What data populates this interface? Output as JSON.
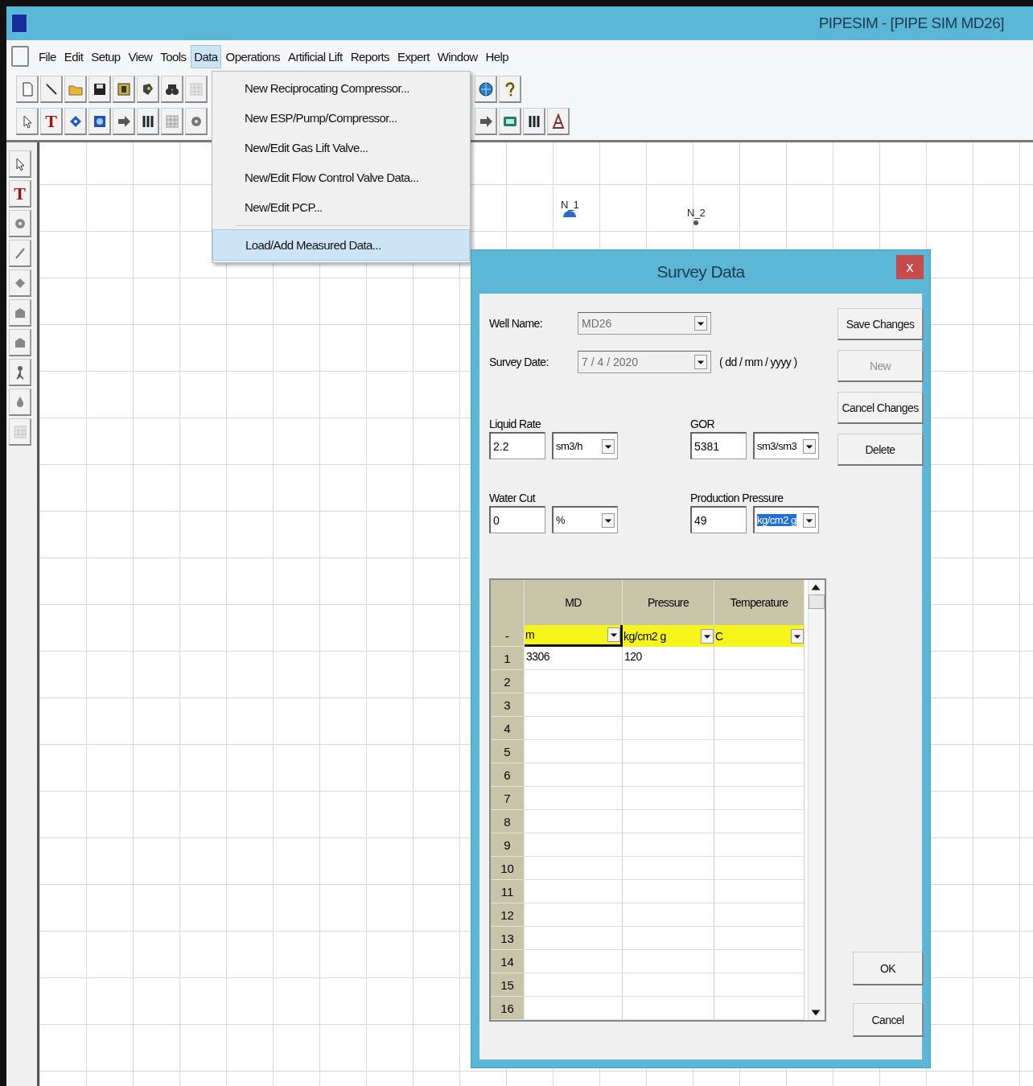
{
  "window": {
    "title": "PIPESIM - [PIPE SIM MD26]"
  },
  "menu_bar": [
    {
      "label": "File",
      "selected": false
    },
    {
      "label": "Edit",
      "selected": false
    },
    {
      "label": "Setup",
      "selected": false
    },
    {
      "label": "View",
      "selected": false
    },
    {
      "label": "Tools",
      "selected": false
    },
    {
      "label": "Data",
      "selected": true
    },
    {
      "label": "Operations",
      "selected": false
    },
    {
      "label": "Artificial Lift",
      "selected": false
    },
    {
      "label": "Reports",
      "selected": false
    },
    {
      "label": "Expert",
      "selected": false
    },
    {
      "label": "Window",
      "selected": false
    },
    {
      "label": "Help",
      "selected": false
    }
  ],
  "toolbar_rows": [
    {
      "groups": [
        [
          {
            "kind": "page"
          },
          {
            "kind": "wand"
          },
          {
            "kind": "folder"
          },
          {
            "kind": "disk"
          },
          {
            "kind": "book"
          },
          {
            "kind": "stamp"
          },
          {
            "kind": "binoculars"
          },
          {
            "kind": "grid",
            "disabled": true
          }
        ],
        [
          {
            "kind": "globe"
          },
          {
            "kind": "bulb"
          }
        ]
      ]
    },
    {
      "groups": [
        [
          {
            "kind": "pointer"
          },
          {
            "kind": "glyph",
            "glyph": "T"
          },
          {
            "kind": "diamond"
          },
          {
            "kind": "square"
          },
          {
            "kind": "arrow"
          },
          {
            "kind": "bars"
          },
          {
            "kind": "grid"
          },
          {
            "kind": "gear"
          }
        ],
        [
          {
            "kind": "arrow"
          },
          {
            "kind": "screen"
          },
          {
            "kind": "bars"
          },
          {
            "kind": "rig"
          }
        ]
      ]
    }
  ],
  "side_toolbar": [
    {
      "kind": "pointer"
    },
    {
      "kind": "glyph",
      "glyph": "T"
    },
    {
      "kind": "circle"
    },
    {
      "kind": "slash"
    },
    {
      "kind": "blob"
    },
    {
      "kind": "well"
    },
    {
      "kind": "well"
    },
    {
      "kind": "figure"
    },
    {
      "kind": "drop"
    },
    {
      "kind": "grid",
      "disabled": true
    }
  ],
  "canvas": {
    "nodes": [
      {
        "label": "N_1",
        "kind": "source"
      },
      {
        "label": "N_2",
        "kind": "junction"
      }
    ]
  },
  "data_menu": {
    "items": [
      {
        "label": "New Reciprocating Compressor...",
        "selected": false,
        "separator_before": false
      },
      {
        "label": "New ESP/Pump/Compressor...",
        "selected": false,
        "separator_before": false
      },
      {
        "label": "New/Edit Gas Lift Valve...",
        "selected": false,
        "separator_before": false
      },
      {
        "label": "New/Edit Flow Control Valve Data...",
        "selected": false,
        "separator_before": false
      },
      {
        "label": "New/Edit PCP...",
        "selected": false,
        "separator_before": false
      },
      {
        "label": "Load/Add Measured Data...",
        "selected": true,
        "separator_before": true
      }
    ]
  },
  "dialog": {
    "title": "Survey Data",
    "close_label": "x",
    "well_name": {
      "label": "Well Name:",
      "value": "MD26",
      "disabled": true
    },
    "survey_date": {
      "label": "Survey Date:",
      "value": "7 / 4 / 2020",
      "disabled": true,
      "hint": "( dd / mm / yyyy )"
    },
    "quantities": [
      {
        "label": "Liquid Rate",
        "value": "2.2",
        "unit": "sm3/h",
        "unit_selected": false
      },
      {
        "label": "GOR",
        "value": "5381",
        "unit": "sm3/sm3",
        "unit_selected": false
      },
      {
        "label": "Water Cut",
        "value": "0",
        "unit": "%",
        "unit_selected": false
      },
      {
        "label": "Production Pressure",
        "value": "49",
        "unit": "kg/cm2 g",
        "unit_selected": true
      }
    ],
    "side_buttons": [
      {
        "label": "Save Changes",
        "disabled": false
      },
      {
        "label": "New",
        "disabled": true
      },
      {
        "label": "Cancel Changes",
        "disabled": false
      },
      {
        "label": "Delete",
        "disabled": false
      }
    ],
    "table": {
      "columns": [
        "MD",
        "Pressure",
        "Temperature"
      ],
      "unit_marker": "-",
      "units": [
        {
          "label": "m",
          "selected": true
        },
        {
          "label": "kg/cm2 g",
          "selected": false
        },
        {
          "label": "C",
          "selected": false
        }
      ],
      "rows": [
        {
          "number": "1",
          "values": [
            "3306",
            "120"
          ]
        },
        {
          "number": "2"
        },
        {
          "number": "3"
        },
        {
          "number": "4"
        },
        {
          "number": "5"
        },
        {
          "number": "6"
        },
        {
          "number": "7"
        },
        {
          "number": "8"
        },
        {
          "number": "9"
        },
        {
          "number": "10"
        },
        {
          "number": "11"
        },
        {
          "number": "12"
        },
        {
          "number": "13"
        },
        {
          "number": "14"
        },
        {
          "number": "15"
        },
        {
          "number": "16"
        }
      ]
    },
    "bottom_buttons": [
      {
        "label": "OK",
        "disabled": false
      },
      {
        "label": "Cancel",
        "disabled": false
      }
    ]
  }
}
